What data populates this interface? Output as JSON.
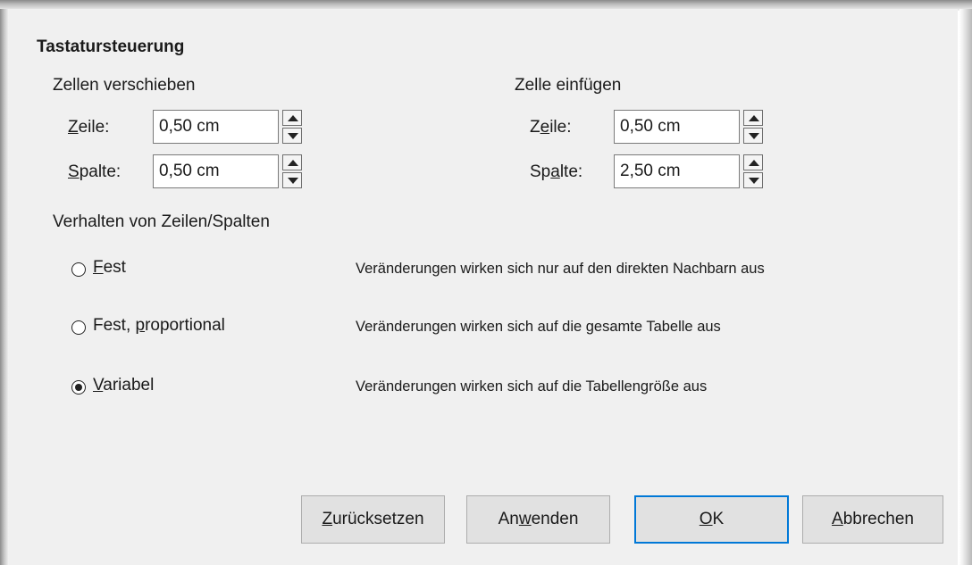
{
  "section": {
    "title": "Tastatursteuerung"
  },
  "move_cells": {
    "title": "Zellen verschieben",
    "row": {
      "label_mn": "Z",
      "label_rest": "eile:",
      "value": "0,50 cm"
    },
    "column": {
      "label_mn": "S",
      "label_rest": "palte:",
      "value": "0,50 cm"
    }
  },
  "insert_cell": {
    "title": "Zelle einfügen",
    "row": {
      "label_pre": "Z",
      "label_mn": "e",
      "label_rest": "ile:",
      "value": "0,50 cm"
    },
    "column": {
      "label_pre": "Sp",
      "label_mn": "a",
      "label_rest": "lte:",
      "value": "2,50 cm"
    }
  },
  "behavior": {
    "title": "Verhalten von Zeilen/Spalten",
    "options": [
      {
        "label_mn": "F",
        "label_rest": "est",
        "description": "Veränderungen wirken sich nur auf den direkten Nachbarn aus",
        "selected": false
      },
      {
        "label_pre": "Fest, ",
        "label_mn": "p",
        "label_rest": "roportional",
        "description": "Veränderungen wirken sich auf die gesamte Tabelle aus",
        "selected": false
      },
      {
        "label_mn": "V",
        "label_rest": "ariabel",
        "description": "Veränderungen wirken sich auf die Tabellengröße aus",
        "selected": true
      }
    ]
  },
  "buttons": {
    "reset": {
      "mn": "Z",
      "rest": "urücksetzen"
    },
    "apply": {
      "pre": "An",
      "mn": "w",
      "rest": "enden"
    },
    "ok": {
      "mn": "O",
      "rest": "K"
    },
    "cancel": {
      "mn": "A",
      "rest": "bbrechen"
    }
  },
  "colors": {
    "default_button_border": "#0078d7",
    "dialog_bg": "#f0f0f0"
  }
}
